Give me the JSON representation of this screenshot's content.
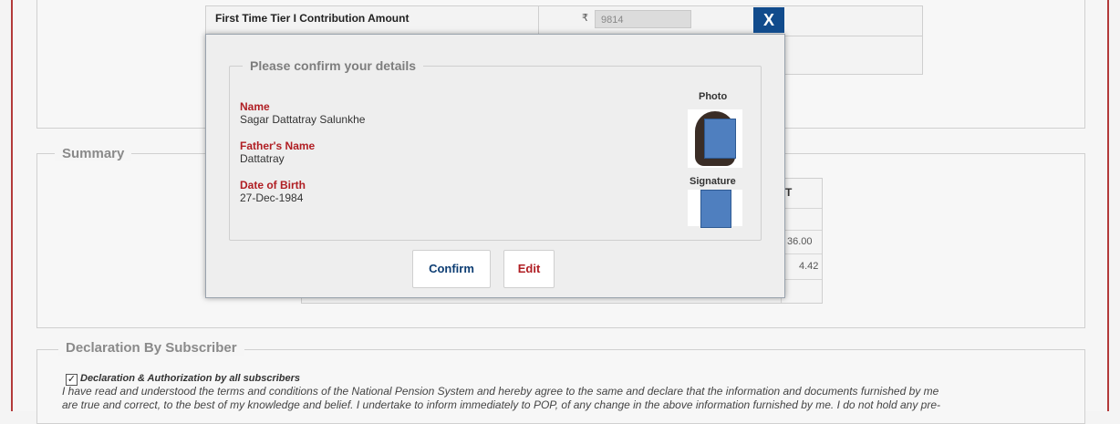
{
  "background": {
    "contribution": {
      "label": "First Time Tier I Contribution Amount",
      "currency_symbol": "₹",
      "amount": "9814"
    },
    "summary": {
      "legend": "Summary",
      "header_fragment": "T",
      "values": [
        "36.00",
        "4.42"
      ]
    },
    "declaration": {
      "legend": "Declaration By Subscriber",
      "checkbox_checked": true,
      "checkbox_label": "Declaration & Authorization by all subscribers",
      "text_line1": "I have read and understood the terms and conditions of the National Pension System and hereby agree to the same and declare that the information and documents furnished by me",
      "text_line2": "are true and correct, to the best of my knowledge and belief. I undertake to inform immediately to POP, of any change in the above information furnished by me. I do not hold any pre-"
    }
  },
  "modal": {
    "close_label": "X",
    "legend": "Please confirm your details",
    "fields": [
      {
        "label": "Name",
        "value": "Sagar Dattatray Salunkhe"
      },
      {
        "label": "Father's Name",
        "value": "Dattatray"
      },
      {
        "label": "Date of Birth",
        "value": "27-Dec-1984"
      }
    ],
    "photo_label": "Photo",
    "signature_label": "Signature",
    "confirm_label": "Confirm",
    "edit_label": "Edit"
  },
  "colors": {
    "accent_blue": "#114b8c",
    "label_red": "#b01e23",
    "page_border_red": "#b33a3a"
  }
}
